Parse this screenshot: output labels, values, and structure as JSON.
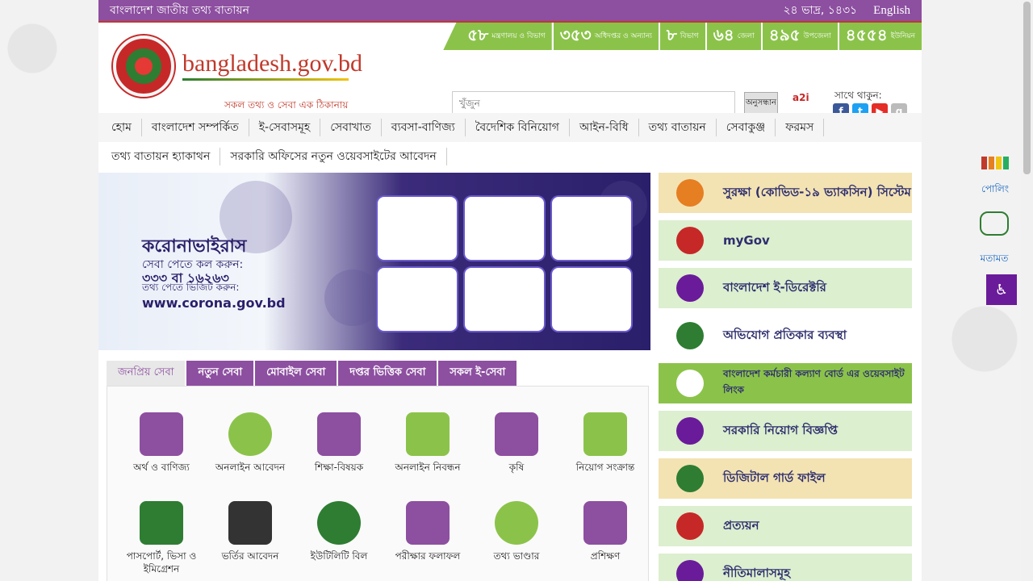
{
  "topbar": {
    "title": "বাংলাদেশ জাতীয় তথ্য বাতায়ন",
    "date": "২৪ ভাদ্র, ১৪৩১",
    "language": "English"
  },
  "header": {
    "site_name": "bangladesh.gov.bd",
    "tagline": "সকল তথ্য ও সেবা এক ঠিকানায়",
    "search_placeholder": "খুঁজুন",
    "search_button": "অনুসন্ধান",
    "a2i_label": "a2i",
    "social_title": "সাথে থাকুন:"
  },
  "stats": [
    {
      "num": "৫৮",
      "label": "মন্ত্রণালয় ও বিভাগ"
    },
    {
      "num": "৩৫৩",
      "label": "অধিদপ্তর ও অন্যান্য"
    },
    {
      "num": "৮",
      "label": "বিভাগ"
    },
    {
      "num": "৬৪",
      "label": "জেলা"
    },
    {
      "num": "৪৯৫",
      "label": "উপজেলা"
    },
    {
      "num": "৪৫৫৪",
      "label": "ইউনিয়ন"
    }
  ],
  "nav": {
    "row1": [
      "হোম",
      "বাংলাদেশ সম্পর্কিত",
      "ই-সেবাসমূহ",
      "সেবাখাত",
      "ব্যবসা-বাণিজ্য",
      "বৈদেশিক বিনিয়োগ",
      "আইন-বিধি",
      "তথ্য বাতায়ন",
      "সেবাকুঞ্জ",
      "ফরমস"
    ],
    "row2": [
      "তথ্য বাতায়ন হ্যাকাথন",
      "সরকারি অফিসের নতুন ওয়েবসাইটের আবেদন"
    ]
  },
  "banner": {
    "title": "করোনাভাইরাস",
    "line1": "সেবা পেতে কল করুন:",
    "line2": "৩৩৩ বা ১৬২৬৩",
    "line3": "তথ্য পেতে ভিজিট করুন:",
    "url": "www.corona.gov.bd"
  },
  "tabs": [
    "জনপ্রিয় সেবা",
    "নতুন সেবা",
    "মোবাইল সেবা",
    "দপ্তর ভিত্তিক সেবা",
    "সকল ই-সেবা"
  ],
  "services": [
    {
      "label": "অর্থ ও বাণিজ্য",
      "icon": "finance-icon"
    },
    {
      "label": "অনলাইন আবেদন",
      "icon": "online-apply-icon"
    },
    {
      "label": "শিক্ষা-বিষয়ক",
      "icon": "education-icon"
    },
    {
      "label": "অনলাইন নিবন্ধন",
      "icon": "registration-icon"
    },
    {
      "label": "কৃষি",
      "icon": "agriculture-icon"
    },
    {
      "label": "নিয়োগ সংক্রান্ত",
      "icon": "recruitment-icon"
    },
    {
      "label": "পাসপোর্ট, ভিসা ও ইমিগ্রেশন",
      "icon": "passport-icon"
    },
    {
      "label": "ভর্তির আবেদন",
      "icon": "admission-icon"
    },
    {
      "label": "ইউটিলিটি বিল",
      "icon": "utility-bill-icon"
    },
    {
      "label": "পরীক্ষার ফলাফল",
      "icon": "exam-result-icon"
    },
    {
      "label": "তথ্য ভাণ্ডার",
      "icon": "info-icon"
    },
    {
      "label": "প্রশিক্ষণ",
      "icon": "training-icon"
    }
  ],
  "sidebar": [
    {
      "label": "সুরক্ষা (কোভিড-১৯ ভ্যাকসিন) সিস্টেম",
      "color": "#f3e3b3"
    },
    {
      "label": "myGov",
      "color": "#dcefcf"
    },
    {
      "label": "বাংলাদেশ ই-ডিরেক্টরি",
      "color": "#dcefcf"
    },
    {
      "label": "অভিযোগ প্রতিকার ব্যবস্থা",
      "color": "#ffffff"
    },
    {
      "label": "বাংলাদেশ কর্মচারী কল্যাণ বোর্ড এর ওয়েবসাইট লিংক",
      "color": "#8bc34a"
    },
    {
      "label": "সরকারি নিয়োগ বিজ্ঞপ্তি",
      "color": "#dcefcf"
    },
    {
      "label": "ডিজিটাল গার্ড ফাইল",
      "color": "#f3e3b3"
    },
    {
      "label": "প্রত্যয়ন",
      "color": "#dcefcf"
    },
    {
      "label": "নীতিমালাসমূহ",
      "color": "#dcefcf"
    }
  ],
  "floats": {
    "poll": "পোলিং",
    "opinion": "মতামত"
  },
  "colors": {
    "brand_purple": "#8d4fa0",
    "brand_green": "#8bc34a",
    "brand_red": "#c62828"
  }
}
